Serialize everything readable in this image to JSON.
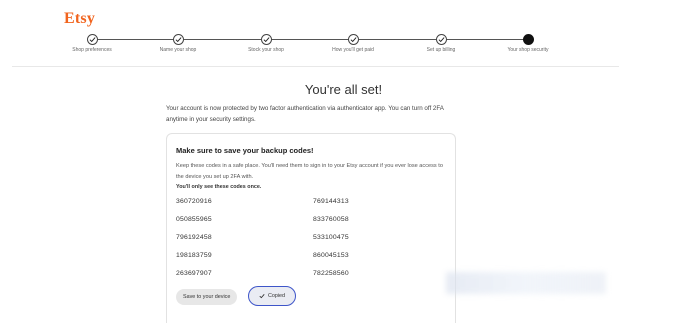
{
  "brand": {
    "logo_text": "Etsy",
    "accent": "#f1641e"
  },
  "stepper": {
    "steps": [
      {
        "label": "Shop preferences",
        "state": "done"
      },
      {
        "label": "Name your shop",
        "state": "done"
      },
      {
        "label": "Stock your shop",
        "state": "done"
      },
      {
        "label": "How you'll get paid",
        "state": "done"
      },
      {
        "label": "Set up billing",
        "state": "done"
      },
      {
        "label": "Your shop security",
        "state": "current"
      }
    ]
  },
  "main": {
    "title": "You're all set!",
    "intro": "Your account is now protected by two factor authentication via authenticator app. You can turn off 2FA anytime in your security settings."
  },
  "backup": {
    "title": "Make sure to save your backup codes!",
    "text": "Keep these codes in a safe place. You'll need them to sign in to your Etsy account if you ever lose access to the device you set up 2FA with.",
    "note": "You'll only see these codes once.",
    "codes": [
      "360720916",
      "769144313",
      "050855965",
      "833760058",
      "796192458",
      "533100475",
      "198183759",
      "860045153",
      "263697907",
      "782258560"
    ],
    "save_label": "Save to your device",
    "copied_label": "Copied",
    "copied_border": "#3e55c9"
  }
}
